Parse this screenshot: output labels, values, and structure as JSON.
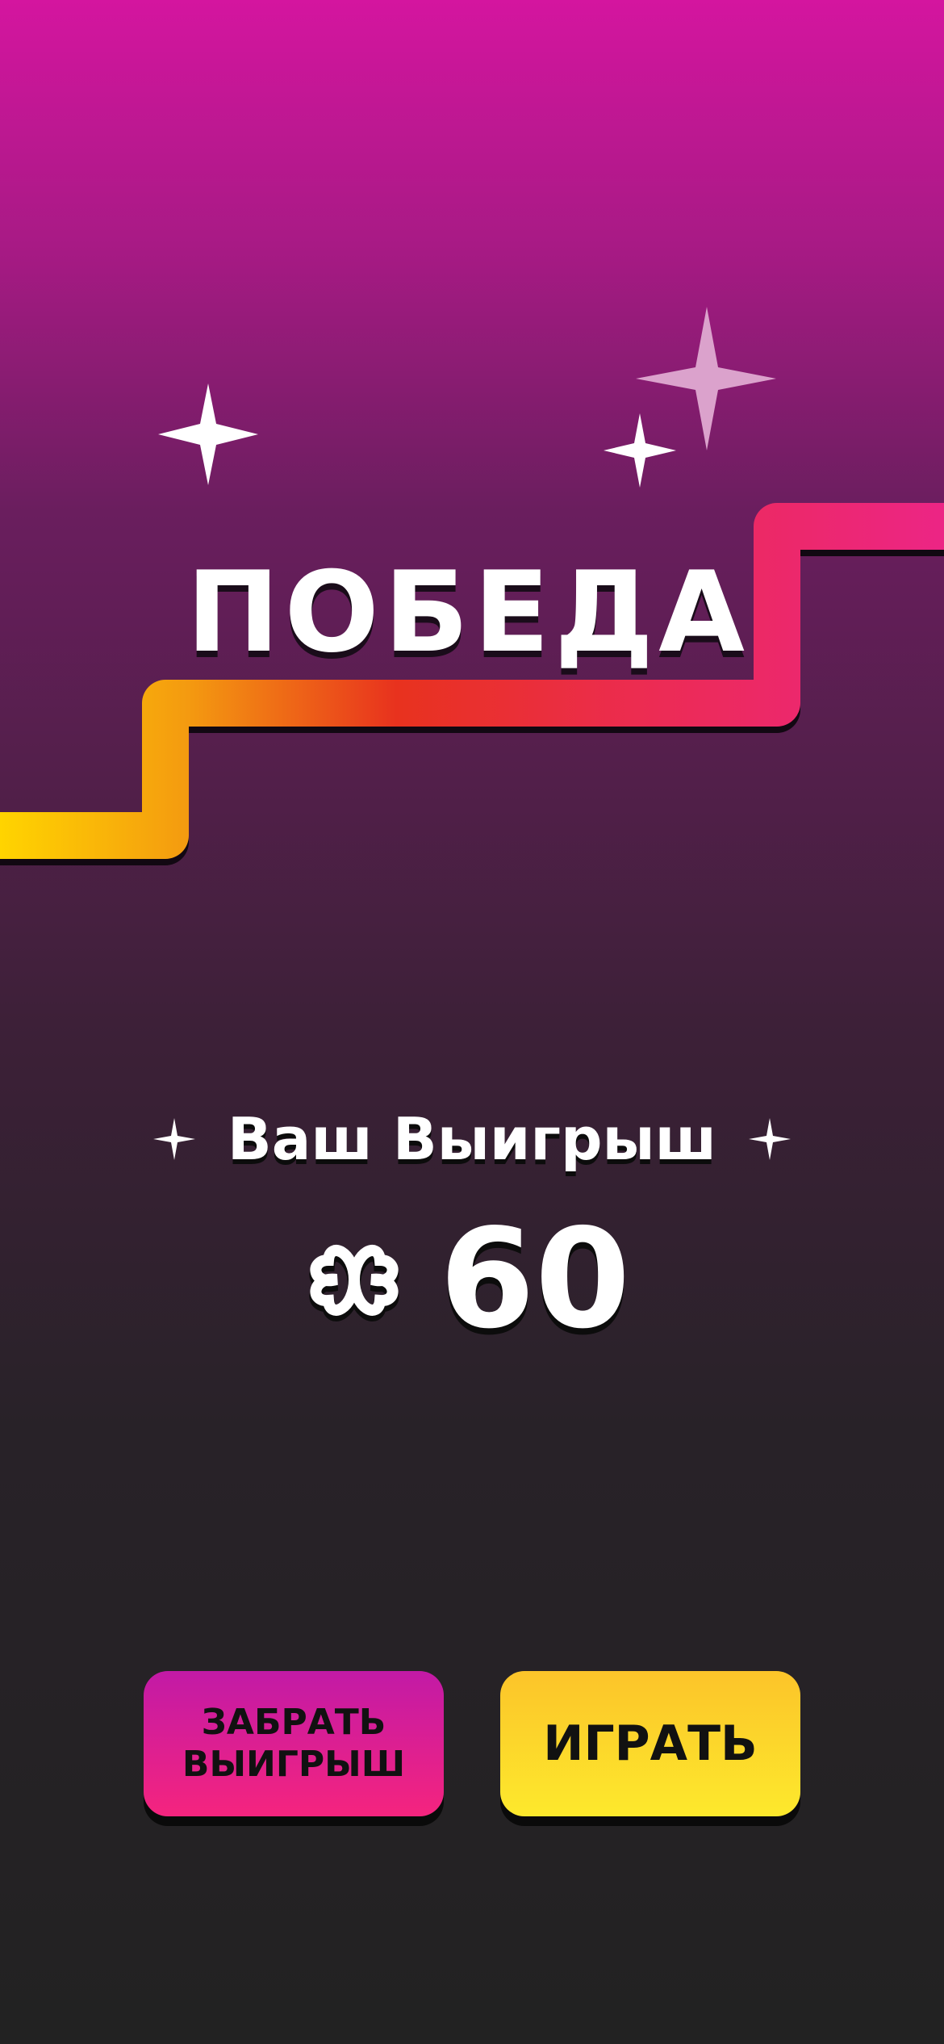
{
  "screen": {
    "title": "ПОБЕДА",
    "winnings_label": "Ваш Выигрыш",
    "amount": "60",
    "currency_icon": "clover-coin-icon"
  },
  "buttons": {
    "collect_label": "ЗАБРАТЬ\nВЫИГРЫШ",
    "play_label": "ИГРАТЬ"
  },
  "colors": {
    "background_top": "#d4159f",
    "background_bottom": "#222222",
    "path_start": "#ffd400",
    "path_mid": "#e8321e",
    "path_end": "#ec2585",
    "collect_button": "#e01f8c",
    "play_button": "#fdd22b",
    "text": "#ffffff"
  }
}
